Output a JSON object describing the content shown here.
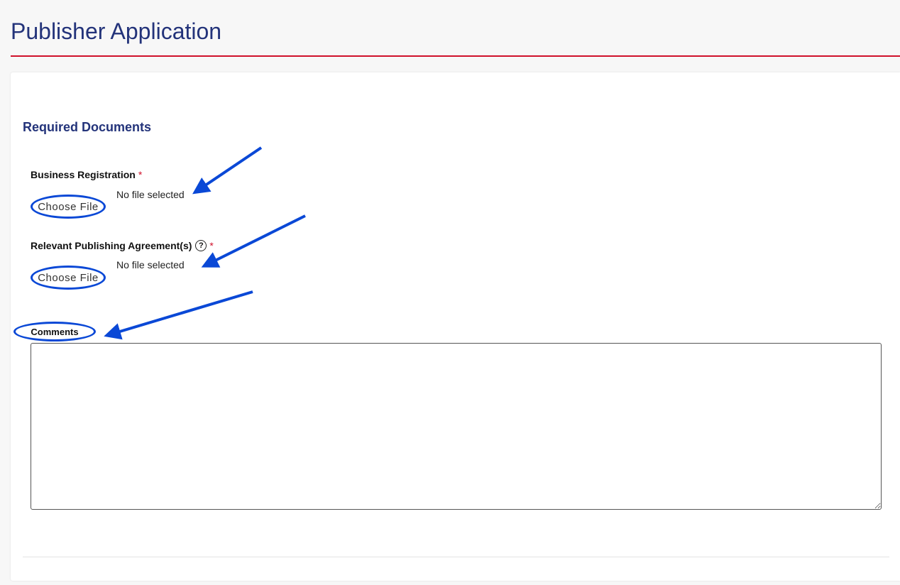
{
  "page": {
    "title": "Publisher Application"
  },
  "form": {
    "section_title": "Required Documents",
    "business_registration": {
      "label": "Business Registration",
      "required_marker": "*",
      "button_label": "Choose File",
      "status": "No file selected"
    },
    "publishing_agreements": {
      "label": "Relevant Publishing Agreement(s)",
      "help_icon": "?",
      "required_marker": "*",
      "button_label": "Choose File",
      "status": "No file selected"
    },
    "comments": {
      "label": "Comments",
      "value": ""
    }
  },
  "colors": {
    "title": "#23337a",
    "header_rule": "#d0112b",
    "annotation": "#0a48d6",
    "required": "#d0112b"
  }
}
